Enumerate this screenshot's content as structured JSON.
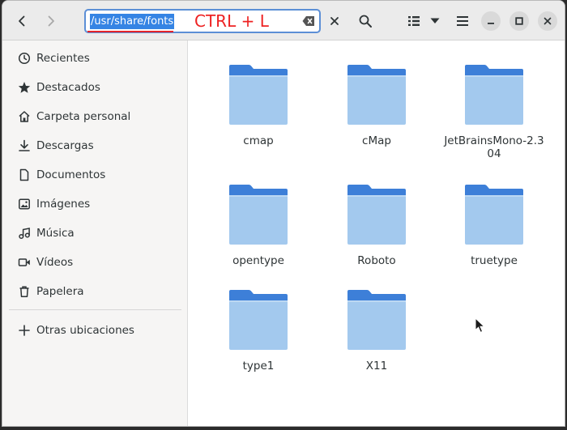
{
  "header": {
    "location_path": "/usr/share/fonts",
    "annotation": "CTRL + L",
    "icons": {
      "back": "chevron-left-icon",
      "forward": "chevron-right-icon",
      "clear": "backspace-clear-icon",
      "close": "close-icon",
      "search": "search-icon",
      "list_view": "list-view-icon",
      "view_options": "dropdown-arrow-icon",
      "menu": "hamburger-menu-icon",
      "minimize": "minimize-icon",
      "maximize": "maximize-icon",
      "window_close": "window-close-icon"
    }
  },
  "sidebar": {
    "items": [
      {
        "label": "Recientes",
        "icon": "clock-icon"
      },
      {
        "label": "Destacados",
        "icon": "star-icon"
      },
      {
        "label": "Carpeta personal",
        "icon": "home-icon"
      },
      {
        "label": "Descargas",
        "icon": "download-icon"
      },
      {
        "label": "Documentos",
        "icon": "document-icon"
      },
      {
        "label": "Imágenes",
        "icon": "image-icon"
      },
      {
        "label": "Música",
        "icon": "music-icon"
      },
      {
        "label": "Vídeos",
        "icon": "video-icon"
      },
      {
        "label": "Papelera",
        "icon": "trash-icon"
      }
    ],
    "other_locations": {
      "label": "Otras ubicaciones",
      "icon": "plus-icon"
    }
  },
  "files": [
    {
      "name": "cmap"
    },
    {
      "name": "cMap"
    },
    {
      "name": "JetBrainsMono-2.304"
    },
    {
      "name": "opentype"
    },
    {
      "name": "Roboto"
    },
    {
      "name": "truetype"
    },
    {
      "name": "type1"
    },
    {
      "name": "X11"
    }
  ],
  "colors": {
    "accent": "#3584e4",
    "annotation": "#ee2222",
    "folder_top": "#3d7fd8",
    "folder_front": "#a3c9ee"
  }
}
